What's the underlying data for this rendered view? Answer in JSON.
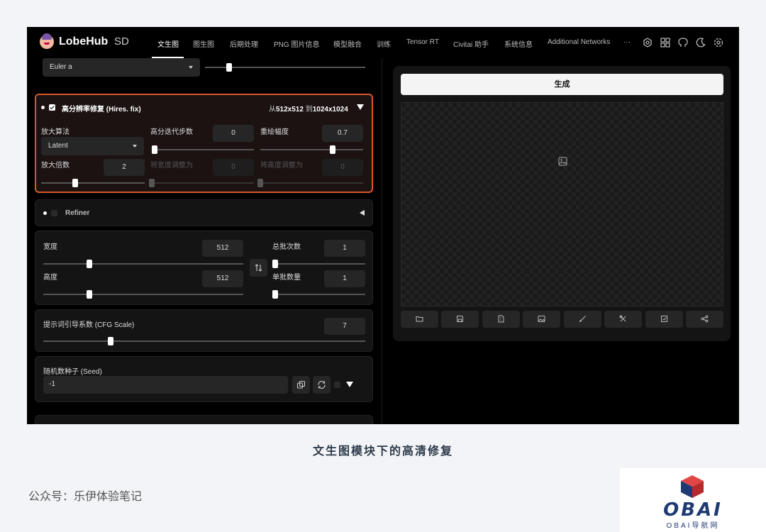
{
  "app": {
    "brand": "LobeHub",
    "brand_sub": "SD"
  },
  "nav": {
    "items": [
      "文生图",
      "图生图",
      "后期处理",
      "PNG 图片信息",
      "模型融合",
      "训练",
      "Tensor RT",
      "Civitai 助手",
      "系统信息",
      "Additional Networks",
      "···"
    ],
    "active_index": 0,
    "icons": [
      "gear-icon",
      "grid-icon",
      "github-icon",
      "moon-icon",
      "settings-icon"
    ]
  },
  "sampler": {
    "value": "Euler a",
    "steps_fraction": 0.15
  },
  "hires": {
    "enabled": true,
    "title": "高分辨率修复 (Hires. fix)",
    "from_label": "从",
    "from_size": "512x512",
    "to_label": "到",
    "to_size": "1024x1024",
    "upscaler_label": "放大算法",
    "upscaler_value": "Latent",
    "steps_label": "高分迭代步数",
    "steps_value": "0",
    "denoise_label": "重绘幅度",
    "denoise_value": "0.7",
    "scale_label": "放大倍数",
    "scale_value": "2",
    "resize_w_label": "将宽度调整为",
    "resize_w_value": "0",
    "resize_h_label": "将高度调整为",
    "resize_h_value": "0",
    "steps_fraction": 0.0,
    "denoise_fraction": 0.7,
    "scale_fraction": 0.33
  },
  "refiner": {
    "label": "Refiner",
    "enabled": false
  },
  "size": {
    "width_label": "宽度",
    "width_value": "512",
    "height_label": "高度",
    "height_value": "512",
    "batch_count_label": "总批次数",
    "batch_count_value": "1",
    "batch_size_label": "单批数量",
    "batch_size_value": "1",
    "width_fraction": 0.23,
    "height_fraction": 0.23
  },
  "cfg": {
    "label": "提示词引导系数 (CFG Scale)",
    "value": "7",
    "fraction": 0.21
  },
  "seed": {
    "label": "随机数种子 (Seed)",
    "value": "-1"
  },
  "output": {
    "generate_label": "生成",
    "tools": [
      "folder-icon",
      "save-icon",
      "zip-icon",
      "image-icon",
      "brush-icon",
      "tools-icon",
      "export-icon",
      "share-icon"
    ]
  },
  "page": {
    "caption": "文生图模块下的高清修复",
    "account": "公众号：乐伊体验笔记",
    "watermark": "OBAI",
    "watermark_sub": "OBAI导航网"
  }
}
